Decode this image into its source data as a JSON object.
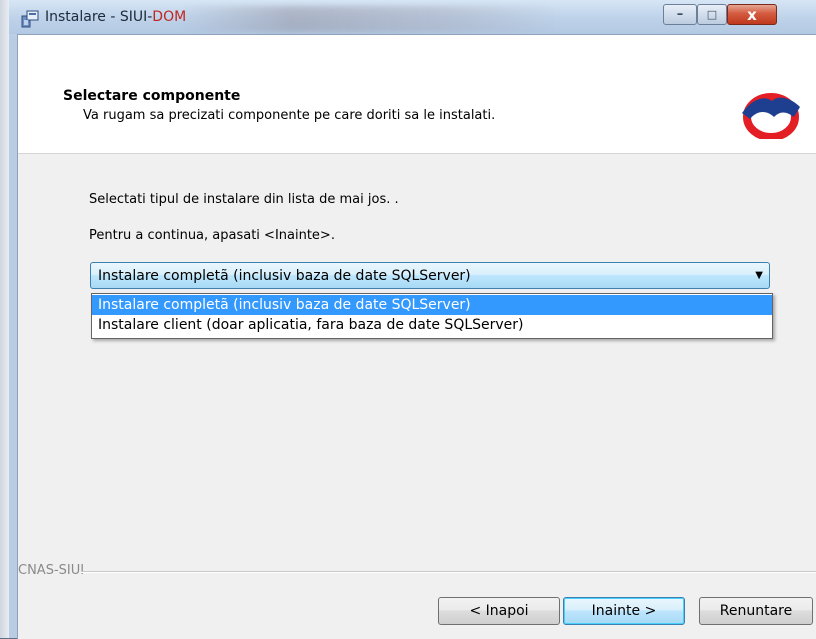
{
  "window": {
    "title_prefix": "Instalare - SIUI-",
    "title_suffix": "DOM",
    "minimize_glyph": "–",
    "maximize_glyph": "□",
    "close_glyph": "x"
  },
  "header": {
    "title": "Selectare componente",
    "subtitle": "Va rugam sa precizati componente pe care doriti sa le instalati."
  },
  "body": {
    "instruction1": "Selectati tipul de instalare din lista de mai jos. .",
    "instruction2": "Pentru a continua, apasati <Inainte>."
  },
  "combo": {
    "selected": "Instalare completã (inclusiv baza de date SQLServer)",
    "options": [
      "Instalare completã (inclusiv baza de date SQLServer)",
      "Instalare client (doar aplicatia, fara baza de date SQLServer)"
    ]
  },
  "footer": {
    "label": "CNAS-SIUI",
    "back_button": "< Inapoi",
    "next_button": "Inainte >",
    "cancel_button": "Renuntare"
  },
  "colors": {
    "accent": "#3399ff",
    "title_dom": "#c0261f",
    "logo_red": "#e31e24",
    "logo_blue": "#1e3f8f"
  }
}
